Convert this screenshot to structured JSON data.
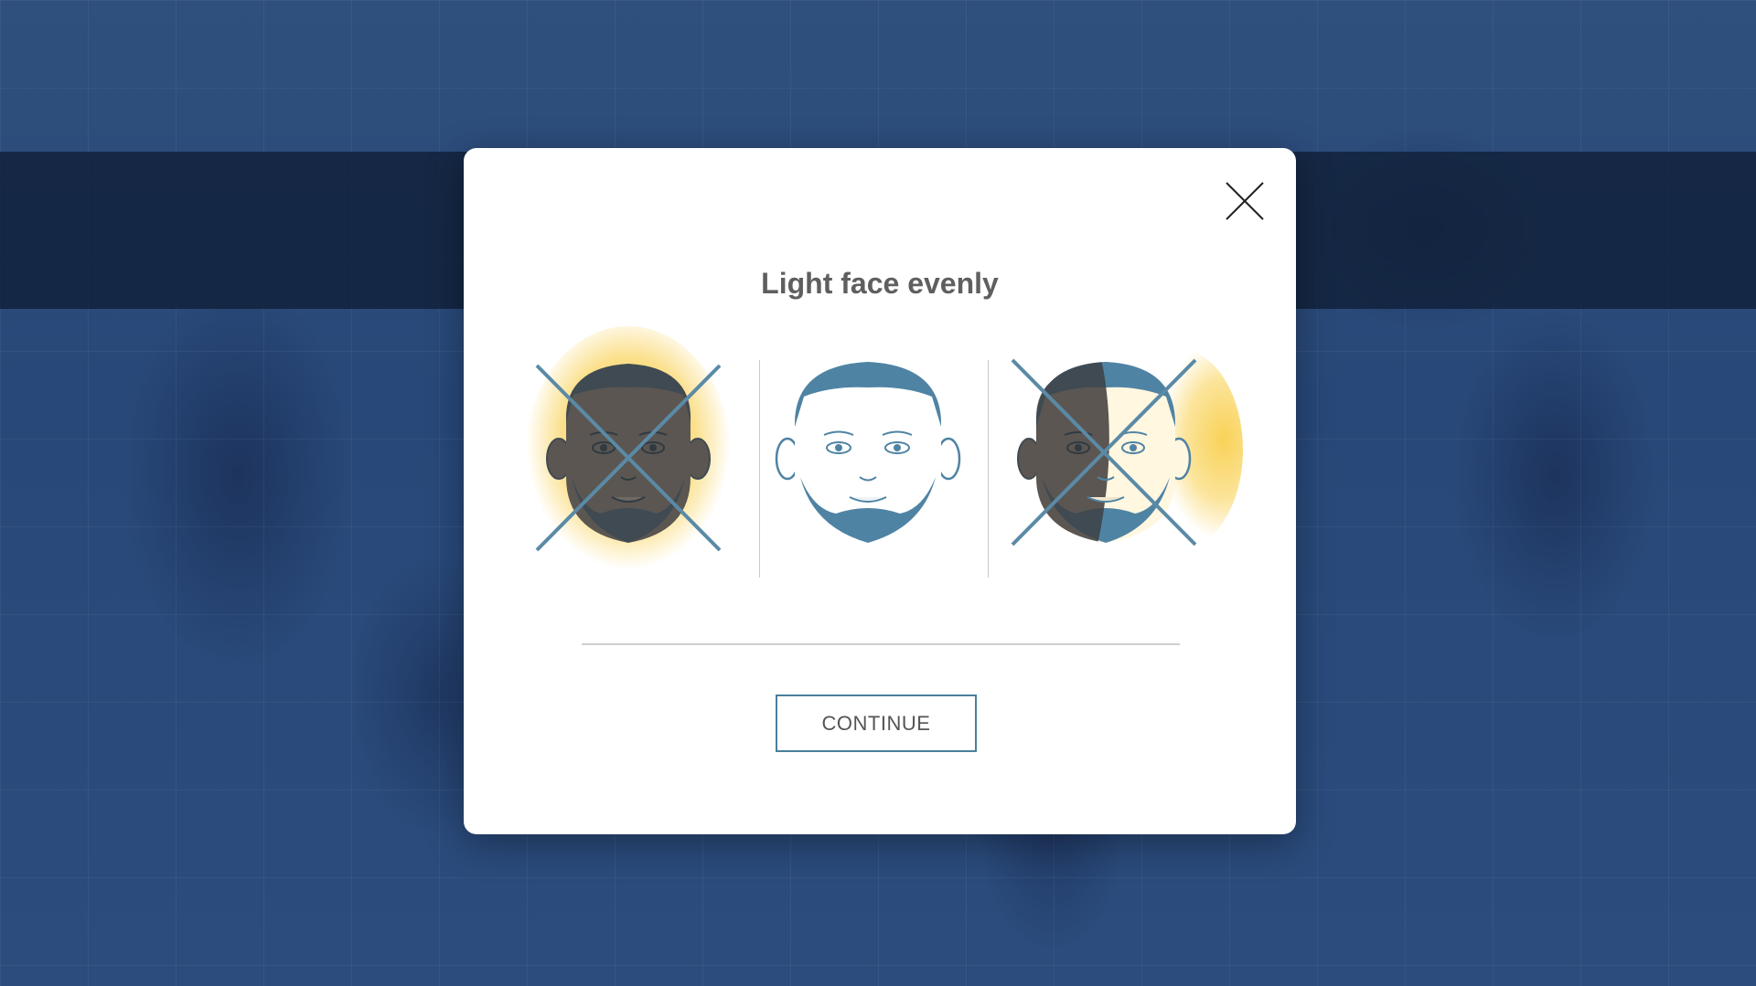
{
  "modal": {
    "title": "Light face evenly",
    "continue_label": "CONTINUE",
    "close_icon": "close-icon"
  },
  "examples": [
    {
      "id": "face-backlit",
      "status": "incorrect",
      "icon": "face-backlit-icon",
      "marker": "cross-mark-icon"
    },
    {
      "id": "face-even",
      "status": "correct",
      "icon": "face-even-light-icon"
    },
    {
      "id": "face-side",
      "status": "incorrect",
      "icon": "face-side-lit-icon",
      "marker": "cross-mark-icon"
    }
  ],
  "colors": {
    "accent": "#4a7f9c",
    "face_line": "#4f83a3",
    "glow": "#f9d258",
    "dark_skin": "#5b5652",
    "hair_dark": "#3f4a52",
    "modal_bg": "#ffffff",
    "title_text": "#5f5f5f"
  }
}
